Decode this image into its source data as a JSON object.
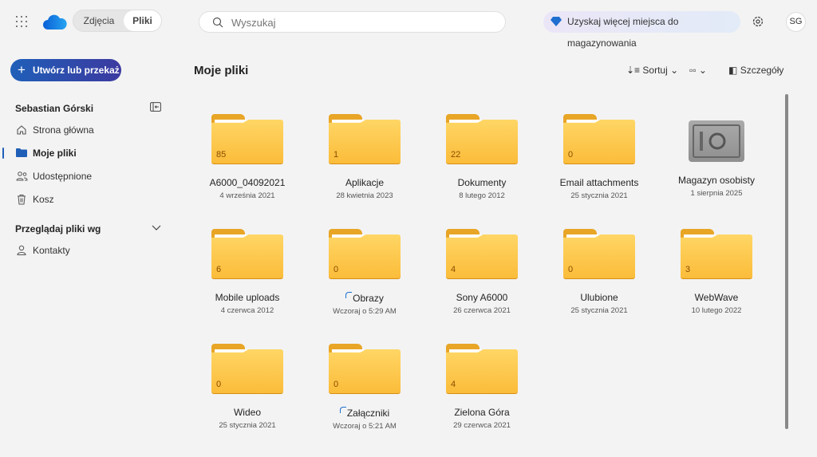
{
  "header": {
    "tabs": [
      "Zdjęcia",
      "Pliki"
    ],
    "active_tab": "Pliki",
    "search_placeholder": "Wyszukaj",
    "promo": "Uzyskaj więcej miejsca do magazynowania",
    "avatar": "SG"
  },
  "sidebar": {
    "create_label": "Utwórz lub przekaż",
    "user": "Sebastian Górski",
    "items": [
      {
        "label": "Strona główna",
        "icon": "home-icon"
      },
      {
        "label": "Moje pliki",
        "icon": "folder-icon",
        "active": true
      },
      {
        "label": "Udostępnione",
        "icon": "people-icon"
      },
      {
        "label": "Kosz",
        "icon": "trash-icon"
      }
    ],
    "browse_label": "Przeglądaj pliki wg",
    "browse_items": [
      {
        "label": "Kontakty",
        "icon": "person-icon"
      }
    ]
  },
  "main": {
    "title": "Moje pliki",
    "sort_label": "Sortuj",
    "details_label": "Szczegóły",
    "items": [
      {
        "name": "A6000_04092021",
        "date": "4 września 2021",
        "count": "85",
        "type": "folder"
      },
      {
        "name": "Aplikacje",
        "date": "28 kwietnia 2023",
        "count": "1",
        "type": "folder"
      },
      {
        "name": "Dokumenty",
        "date": "8 lutego 2012",
        "count": "22",
        "type": "folder"
      },
      {
        "name": "Email attachments",
        "date": "25 stycznia 2021",
        "count": "0",
        "type": "folder"
      },
      {
        "name": "Magazyn osobisty",
        "date": "1 sierpnia 2025",
        "type": "vault"
      },
      {
        "name": "Mobile uploads",
        "date": "4 czerwca 2012",
        "count": "6",
        "type": "folder"
      },
      {
        "name": "Obrazy",
        "date": "Wczoraj o 5:29 AM",
        "count": "0",
        "type": "folder",
        "syncing": true
      },
      {
        "name": "Sony A6000",
        "date": "26 czerwca 2021",
        "count": "4",
        "type": "folder"
      },
      {
        "name": "Ulubione",
        "date": "25 stycznia 2021",
        "count": "0",
        "type": "folder"
      },
      {
        "name": "WebWave",
        "date": "10 lutego 2022",
        "count": "3",
        "type": "folder"
      },
      {
        "name": "Wideo",
        "date": "25 stycznia 2021",
        "count": "0",
        "type": "folder"
      },
      {
        "name": "Załączniki",
        "date": "Wczoraj o 5:21 AM",
        "count": "0",
        "type": "folder",
        "syncing": true
      },
      {
        "name": "Zielona Góra",
        "date": "29 czerwca 2021",
        "count": "4",
        "type": "folder"
      }
    ]
  },
  "colors": {
    "accent": "#1f5fb8",
    "folder": "#fbbc3a"
  }
}
